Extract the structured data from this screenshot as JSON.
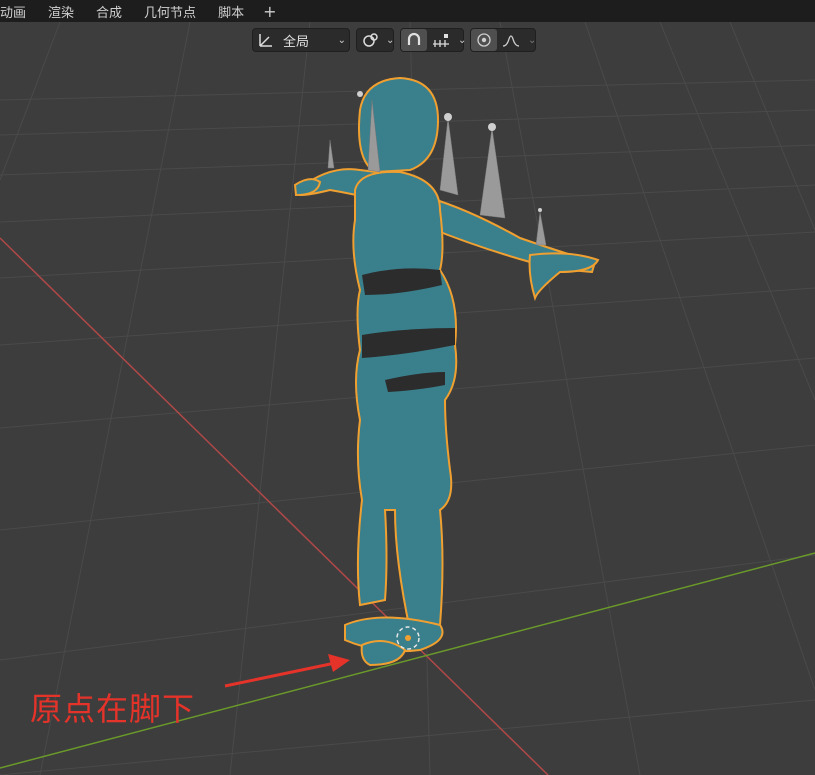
{
  "menu": {
    "tabs": [
      "动画",
      "渲染",
      "合成",
      "几何节点",
      "脚本"
    ],
    "add_label": "+"
  },
  "header": {
    "orientation_value": "全局"
  },
  "annotation": {
    "text": "原点在脚下",
    "color": "#e5332a"
  },
  "colors": {
    "mesh": "#3a7f8c",
    "selection_outline": "#f0a030",
    "viewport_bg": "#3d3d3d",
    "x_axis": "#c04848",
    "y_axis": "#6a9a2a"
  },
  "icons": {
    "transform_orientation": "axis-orientation-icon",
    "pivot": "pivot-point-icon",
    "snap": "snap-magnet-icon",
    "snap_target": "snap-increment-icon",
    "proportional": "proportional-edit-icon",
    "falloff": "falloff-curve-icon"
  }
}
